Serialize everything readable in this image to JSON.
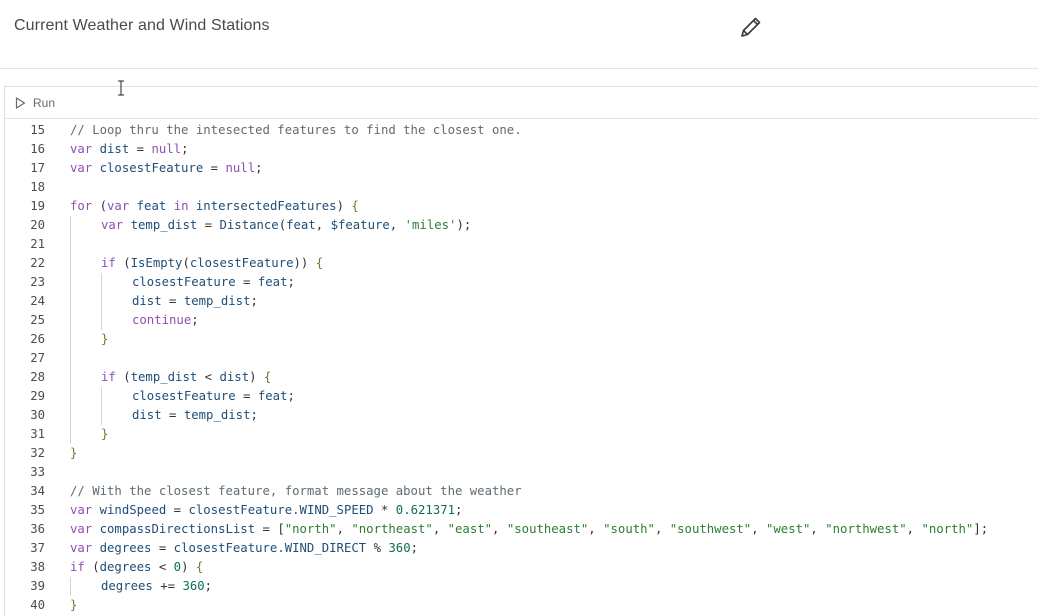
{
  "header": {
    "title": "Current Weather and Wind Stations",
    "edit_icon": "pencil-icon"
  },
  "toolbar": {
    "run_label": "Run",
    "run_icon": "play-icon"
  },
  "editor": {
    "lines": [
      {
        "n": "15",
        "indent": 0,
        "tokens": [
          [
            "com",
            "// Loop thru the intesected features to find the closest one."
          ]
        ]
      },
      {
        "n": "16",
        "indent": 0,
        "tokens": [
          [
            "kw",
            "var"
          ],
          [
            "pun",
            " "
          ],
          [
            "id",
            "dist"
          ],
          [
            "pun",
            " = "
          ],
          [
            "kw",
            "null"
          ],
          [
            "pun",
            ";"
          ]
        ]
      },
      {
        "n": "17",
        "indent": 0,
        "tokens": [
          [
            "kw",
            "var"
          ],
          [
            "pun",
            " "
          ],
          [
            "id",
            "closestFeature"
          ],
          [
            "pun",
            " = "
          ],
          [
            "kw",
            "null"
          ],
          [
            "pun",
            ";"
          ]
        ]
      },
      {
        "n": "18",
        "indent": 0,
        "tokens": []
      },
      {
        "n": "19",
        "indent": 0,
        "tokens": [
          [
            "kw",
            "for"
          ],
          [
            "pun",
            " ("
          ],
          [
            "kw",
            "var"
          ],
          [
            "pun",
            " "
          ],
          [
            "id",
            "feat"
          ],
          [
            "pun",
            " "
          ],
          [
            "kw",
            "in"
          ],
          [
            "pun",
            " "
          ],
          [
            "id",
            "intersectedFeatures"
          ],
          [
            "pun",
            ") "
          ],
          [
            "brk",
            "{"
          ]
        ]
      },
      {
        "n": "20",
        "indent": 1,
        "tokens": [
          [
            "kw",
            "var"
          ],
          [
            "pun",
            " "
          ],
          [
            "id",
            "temp_dist"
          ],
          [
            "pun",
            " = "
          ],
          [
            "fn",
            "Distance"
          ],
          [
            "pun",
            "("
          ],
          [
            "id",
            "feat"
          ],
          [
            "pun",
            ", "
          ],
          [
            "id",
            "$feature"
          ],
          [
            "pun",
            ", "
          ],
          [
            "str",
            "'miles'"
          ],
          [
            "pun",
            ");"
          ]
        ]
      },
      {
        "n": "21",
        "indent": 1,
        "tokens": []
      },
      {
        "n": "22",
        "indent": 1,
        "tokens": [
          [
            "kw",
            "if"
          ],
          [
            "pun",
            " ("
          ],
          [
            "fn",
            "IsEmpty"
          ],
          [
            "pun",
            "("
          ],
          [
            "id",
            "closestFeature"
          ],
          [
            "pun",
            ")) "
          ],
          [
            "brk",
            "{"
          ]
        ]
      },
      {
        "n": "23",
        "indent": 2,
        "tokens": [
          [
            "id",
            "closestFeature"
          ],
          [
            "pun",
            " = "
          ],
          [
            "id",
            "feat"
          ],
          [
            "pun",
            ";"
          ]
        ]
      },
      {
        "n": "24",
        "indent": 2,
        "tokens": [
          [
            "id",
            "dist"
          ],
          [
            "pun",
            " = "
          ],
          [
            "id",
            "temp_dist"
          ],
          [
            "pun",
            ";"
          ]
        ]
      },
      {
        "n": "25",
        "indent": 2,
        "tokens": [
          [
            "kw",
            "continue"
          ],
          [
            "pun",
            ";"
          ]
        ]
      },
      {
        "n": "26",
        "indent": 1,
        "tokens": [
          [
            "brk",
            "}"
          ]
        ]
      },
      {
        "n": "27",
        "indent": 1,
        "tokens": []
      },
      {
        "n": "28",
        "indent": 1,
        "tokens": [
          [
            "kw",
            "if"
          ],
          [
            "pun",
            " ("
          ],
          [
            "id",
            "temp_dist"
          ],
          [
            "pun",
            " < "
          ],
          [
            "id",
            "dist"
          ],
          [
            "pun",
            ") "
          ],
          [
            "brk",
            "{"
          ]
        ]
      },
      {
        "n": "29",
        "indent": 2,
        "tokens": [
          [
            "id",
            "closestFeature"
          ],
          [
            "pun",
            " = "
          ],
          [
            "id",
            "feat"
          ],
          [
            "pun",
            ";"
          ]
        ]
      },
      {
        "n": "30",
        "indent": 2,
        "tokens": [
          [
            "id",
            "dist"
          ],
          [
            "pun",
            " = "
          ],
          [
            "id",
            "temp_dist"
          ],
          [
            "pun",
            ";"
          ]
        ]
      },
      {
        "n": "31",
        "indent": 1,
        "tokens": [
          [
            "brk",
            "}"
          ]
        ]
      },
      {
        "n": "32",
        "indent": 0,
        "tokens": [
          [
            "brk",
            "}"
          ]
        ]
      },
      {
        "n": "33",
        "indent": 0,
        "tokens": []
      },
      {
        "n": "34",
        "indent": 0,
        "tokens": [
          [
            "com",
            "// With the closest feature, format message about the weather"
          ]
        ]
      },
      {
        "n": "35",
        "indent": 0,
        "tokens": [
          [
            "kw",
            "var"
          ],
          [
            "pun",
            " "
          ],
          [
            "id",
            "windSpeed"
          ],
          [
            "pun",
            " = "
          ],
          [
            "id",
            "closestFeature.WIND_SPEED"
          ],
          [
            "pun",
            " * "
          ],
          [
            "num",
            "0.621371"
          ],
          [
            "pun",
            ";"
          ]
        ]
      },
      {
        "n": "36",
        "indent": 0,
        "tokens": [
          [
            "kw",
            "var"
          ],
          [
            "pun",
            " "
          ],
          [
            "id",
            "compassDirectionsList"
          ],
          [
            "pun",
            " = ["
          ],
          [
            "str",
            "\"north\""
          ],
          [
            "pun",
            ", "
          ],
          [
            "str",
            "\"northeast\""
          ],
          [
            "pun",
            ", "
          ],
          [
            "str",
            "\"east\""
          ],
          [
            "pun",
            ", "
          ],
          [
            "str",
            "\"southeast\""
          ],
          [
            "pun",
            ", "
          ],
          [
            "str",
            "\"south\""
          ],
          [
            "pun",
            ", "
          ],
          [
            "str",
            "\"southwest\""
          ],
          [
            "pun",
            ", "
          ],
          [
            "str",
            "\"west\""
          ],
          [
            "pun",
            ", "
          ],
          [
            "str",
            "\"northwest\""
          ],
          [
            "pun",
            ", "
          ],
          [
            "str",
            "\"north\""
          ],
          [
            "pun",
            "];"
          ]
        ]
      },
      {
        "n": "37",
        "indent": 0,
        "tokens": [
          [
            "kw",
            "var"
          ],
          [
            "pun",
            " "
          ],
          [
            "id",
            "degrees"
          ],
          [
            "pun",
            " = "
          ],
          [
            "id",
            "closestFeature.WIND_DIRECT"
          ],
          [
            "pun",
            " % "
          ],
          [
            "num",
            "360"
          ],
          [
            "pun",
            ";"
          ]
        ]
      },
      {
        "n": "38",
        "indent": 0,
        "tokens": [
          [
            "kw",
            "if"
          ],
          [
            "pun",
            " ("
          ],
          [
            "id",
            "degrees"
          ],
          [
            "pun",
            " < "
          ],
          [
            "num",
            "0"
          ],
          [
            "pun",
            ") "
          ],
          [
            "brk",
            "{"
          ]
        ]
      },
      {
        "n": "39",
        "indent": 1,
        "tokens": [
          [
            "id",
            "degrees"
          ],
          [
            "pun",
            " += "
          ],
          [
            "num",
            "360"
          ],
          [
            "pun",
            ";"
          ]
        ]
      },
      {
        "n": "40",
        "indent": 0,
        "tokens": [
          [
            "brk",
            "}"
          ]
        ]
      }
    ]
  },
  "colors": {
    "keyword": "#8f4fb3",
    "string": "#2e7d32",
    "comment": "#5f6b73",
    "number": "#0b6e5a",
    "identifier": "#1f4e79"
  }
}
